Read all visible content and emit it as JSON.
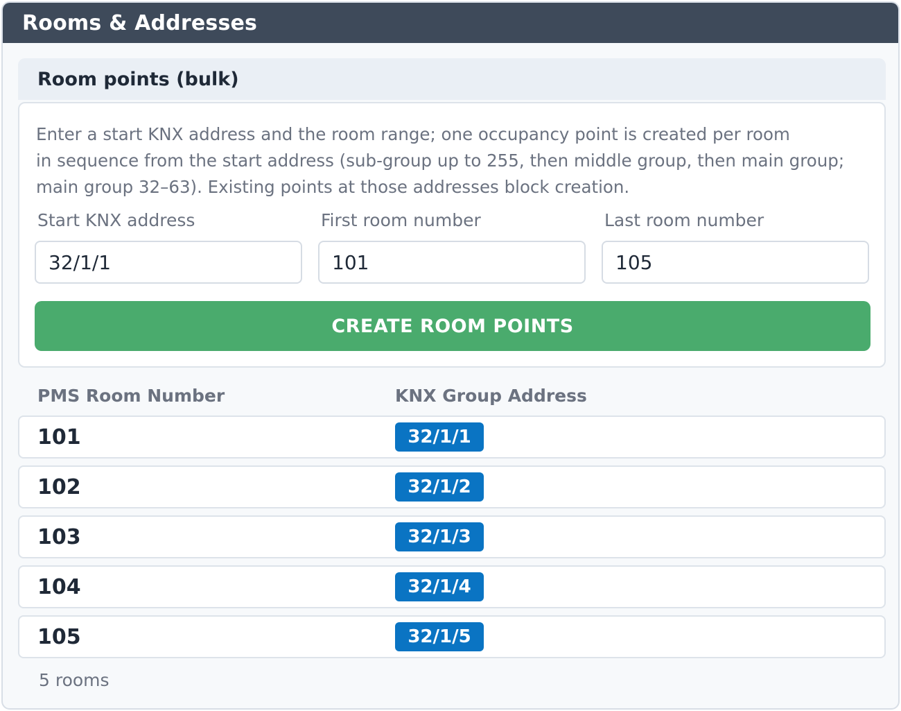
{
  "panel": {
    "title": "Rooms & Addresses"
  },
  "section": {
    "title": "Room points (bulk)",
    "description_lines": [
      "Enter a start KNX address and the room range; one occupancy point is created per room",
      "in sequence from the start address (sub-group up to 255, then middle group, then main group;",
      "main group 32–63). Existing points at those addresses block creation."
    ]
  },
  "form": {
    "start_address": {
      "label": "Start KNX address",
      "value": "32/1/1"
    },
    "first_room": {
      "label": "First room number",
      "value": "101"
    },
    "last_room": {
      "label": "Last room number",
      "value": "105"
    },
    "create_label": "CREATE ROOM POINTS"
  },
  "table": {
    "columns": [
      "PMS Room Number",
      "KNX Group Address"
    ],
    "rows": [
      {
        "room": "101",
        "address": "32/1/1"
      },
      {
        "room": "102",
        "address": "32/1/2"
      },
      {
        "room": "103",
        "address": "32/1/3"
      },
      {
        "room": "104",
        "address": "32/1/4"
      },
      {
        "room": "105",
        "address": "32/1/5"
      }
    ],
    "count_label": "5 rooms"
  },
  "colors": {
    "header_bg": "#3e4a5a",
    "button_green": "#4aab6d",
    "badge_blue": "#0a74c3"
  }
}
